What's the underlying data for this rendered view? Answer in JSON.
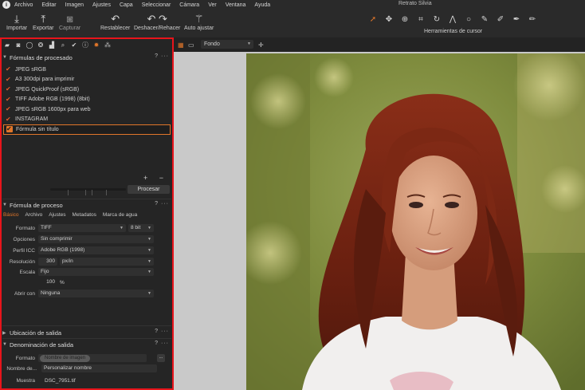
{
  "menu": {
    "app_icon": "i",
    "items": [
      "Archivo",
      "Editar",
      "Imagen",
      "Ajustes",
      "Capa",
      "Seleccionar",
      "Cámara",
      "Ver",
      "Ventana",
      "Ayuda"
    ],
    "window_title": "Retrato Silvia"
  },
  "toolbar": {
    "import_label": "Importar",
    "export_label": "Exportar",
    "capture_label": "Capturar",
    "reset_label": "Restablecer",
    "undo_redo_label": "Deshacer/Rehacer",
    "auto_adjust_label": "Auto ajustar",
    "cursor_tools_label": "Herramientas de cursor"
  },
  "recipes": {
    "title": "Fórmulas de procesado",
    "header_actions": "? ···",
    "items": [
      {
        "label": "JPEG sRGB",
        "checked": true
      },
      {
        "label": "A3 300dpi para imprimir",
        "checked": true
      },
      {
        "label": "JPEG QuickProof (sRGB)",
        "checked": true
      },
      {
        "label": "TIFF Adobe RGB (1998) (8bit)",
        "checked": true
      },
      {
        "label": "JPEG sRGB 1600px para web",
        "checked": true
      },
      {
        "label": "INSTAGRAM",
        "checked": true
      },
      {
        "label": "Fórmula sin título",
        "checked": true,
        "selected": true
      }
    ],
    "add_remove": "+ −",
    "process_button": "Procesar"
  },
  "process_recipe": {
    "title": "Fórmula de proceso",
    "header_actions": "? ···",
    "tabs": [
      "Básico",
      "Archivo",
      "Ajustes",
      "Metadatos",
      "Marca de agua"
    ],
    "active_tab": "Básico",
    "format_label": "Formato",
    "format_value": "TIFF",
    "bit_value": "8 bit",
    "options_label": "Opciones",
    "options_value": "Sin comprimir",
    "icc_label": "Perfil ICC",
    "icc_value": "Adobe RGB (1998)",
    "resolution_label": "Resolución",
    "resolution_value": "300",
    "resolution_unit": "px/in",
    "scale_label": "Escala",
    "scale_value": "Fijo",
    "scale_percent": "100",
    "scale_percent_unit": "%",
    "open_with_label": "Abrir con",
    "open_with_value": "Ninguna"
  },
  "output_location": {
    "title": "Ubicación de salida",
    "header_actions": "? ···"
  },
  "output_naming": {
    "title": "Denominación de salida",
    "header_actions": "? ···",
    "format_label": "Formato",
    "format_token": "Nombre de imagen",
    "format_more": "...",
    "name_label": "Nombre de...",
    "name_value": "Personalizar nombre",
    "sample_label": "Muestra",
    "sample_value": "DSC_7951.tif"
  },
  "viewer": {
    "background_select": "Fondo"
  },
  "colors": {
    "accent": "#e0762a",
    "highlight_frame": "#e8141b",
    "panel_bg": "#252525"
  }
}
